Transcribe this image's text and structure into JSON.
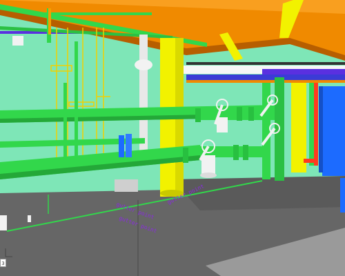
{
  "scene": {
    "floor_labels": [
      "gutter point",
      "gutter point",
      "gutter point"
    ],
    "colors": {
      "wall": "#7ee6b7",
      "floor": "#666666",
      "green_pipe": "#32d74b",
      "orange_pipe": "#f08a00",
      "yellow_column": "#f2f200",
      "blue_cabinet": "#1c6bff",
      "purple_pipe": "#5a30e0",
      "red_pipe": "#ff3b1f",
      "yellow_line": "#f0d000",
      "white_fitting": "#f2f2f2"
    },
    "icons": {
      "axis_gizmo": "axis-icon"
    }
  },
  "corner": {
    "label": "3"
  }
}
